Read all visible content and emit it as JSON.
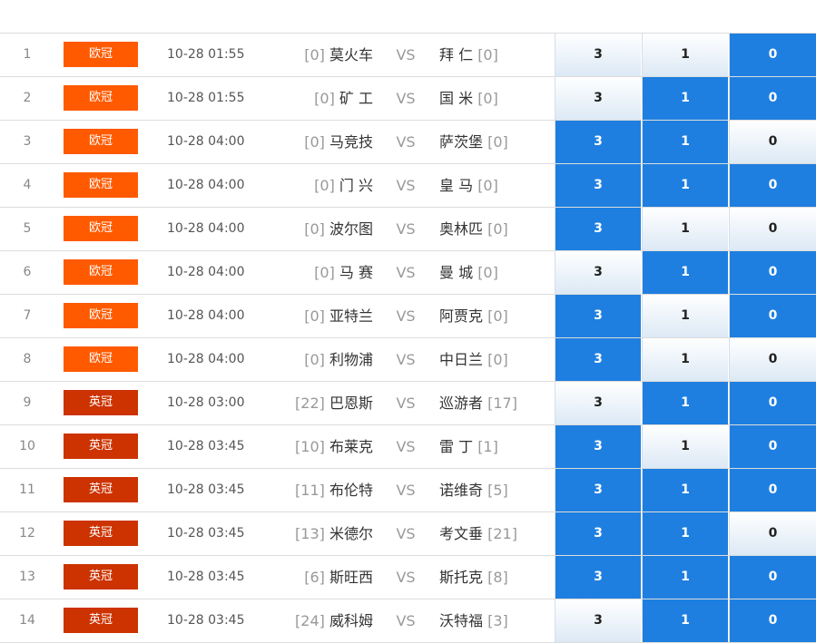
{
  "colors": {
    "selected": "#1e7fe0",
    "league_ucl": "#ff5a00",
    "league_efl": "#cc3300"
  },
  "vs_label": "VS",
  "options": [
    "3",
    "1",
    "0"
  ],
  "matches": [
    {
      "no": "1",
      "league": "欧冠",
      "league_type": "ucl",
      "time": "10-28 01:55",
      "home_rank": "[0]",
      "home": "莫火车",
      "away": "拜 仁",
      "away_rank": "[0]",
      "selected": [
        false,
        false,
        true
      ]
    },
    {
      "no": "2",
      "league": "欧冠",
      "league_type": "ucl",
      "time": "10-28 01:55",
      "home_rank": "[0]",
      "home": "矿 工",
      "away": "国 米",
      "away_rank": "[0]",
      "selected": [
        false,
        true,
        true
      ]
    },
    {
      "no": "3",
      "league": "欧冠",
      "league_type": "ucl",
      "time": "10-28 04:00",
      "home_rank": "[0]",
      "home": "马竞技",
      "away": "萨茨堡",
      "away_rank": "[0]",
      "selected": [
        true,
        true,
        false
      ]
    },
    {
      "no": "4",
      "league": "欧冠",
      "league_type": "ucl",
      "time": "10-28 04:00",
      "home_rank": "[0]",
      "home": "门 兴",
      "away": "皇 马",
      "away_rank": "[0]",
      "selected": [
        true,
        true,
        true
      ]
    },
    {
      "no": "5",
      "league": "欧冠",
      "league_type": "ucl",
      "time": "10-28 04:00",
      "home_rank": "[0]",
      "home": "波尔图",
      "away": "奥林匹",
      "away_rank": "[0]",
      "selected": [
        true,
        false,
        false
      ]
    },
    {
      "no": "6",
      "league": "欧冠",
      "league_type": "ucl",
      "time": "10-28 04:00",
      "home_rank": "[0]",
      "home": "马 赛",
      "away": "曼 城",
      "away_rank": "[0]",
      "selected": [
        false,
        true,
        true
      ]
    },
    {
      "no": "7",
      "league": "欧冠",
      "league_type": "ucl",
      "time": "10-28 04:00",
      "home_rank": "[0]",
      "home": "亚特兰",
      "away": "阿贾克",
      "away_rank": "[0]",
      "selected": [
        true,
        false,
        true
      ]
    },
    {
      "no": "8",
      "league": "欧冠",
      "league_type": "ucl",
      "time": "10-28 04:00",
      "home_rank": "[0]",
      "home": "利物浦",
      "away": "中日兰",
      "away_rank": "[0]",
      "selected": [
        true,
        false,
        false
      ]
    },
    {
      "no": "9",
      "league": "英冠",
      "league_type": "efl",
      "time": "10-28 03:00",
      "home_rank": "[22]",
      "home": "巴恩斯",
      "away": "巡游者",
      "away_rank": "[17]",
      "selected": [
        false,
        true,
        true
      ]
    },
    {
      "no": "10",
      "league": "英冠",
      "league_type": "efl",
      "time": "10-28 03:45",
      "home_rank": "[10]",
      "home": "布莱克",
      "away": "雷 丁",
      "away_rank": "[1]",
      "selected": [
        true,
        false,
        true
      ]
    },
    {
      "no": "11",
      "league": "英冠",
      "league_type": "efl",
      "time": "10-28 03:45",
      "home_rank": "[11]",
      "home": "布伦特",
      "away": "诺维奇",
      "away_rank": "[5]",
      "selected": [
        true,
        true,
        true
      ]
    },
    {
      "no": "12",
      "league": "英冠",
      "league_type": "efl",
      "time": "10-28 03:45",
      "home_rank": "[13]",
      "home": "米德尔",
      "away": "考文垂",
      "away_rank": "[21]",
      "selected": [
        true,
        true,
        false
      ]
    },
    {
      "no": "13",
      "league": "英冠",
      "league_type": "efl",
      "time": "10-28 03:45",
      "home_rank": "[6]",
      "home": "斯旺西",
      "away": "斯托克",
      "away_rank": "[8]",
      "selected": [
        true,
        true,
        true
      ]
    },
    {
      "no": "14",
      "league": "英冠",
      "league_type": "efl",
      "time": "10-28 03:45",
      "home_rank": "[24]",
      "home": "威科姆",
      "away": "沃特福",
      "away_rank": "[3]",
      "selected": [
        false,
        true,
        true
      ]
    }
  ]
}
